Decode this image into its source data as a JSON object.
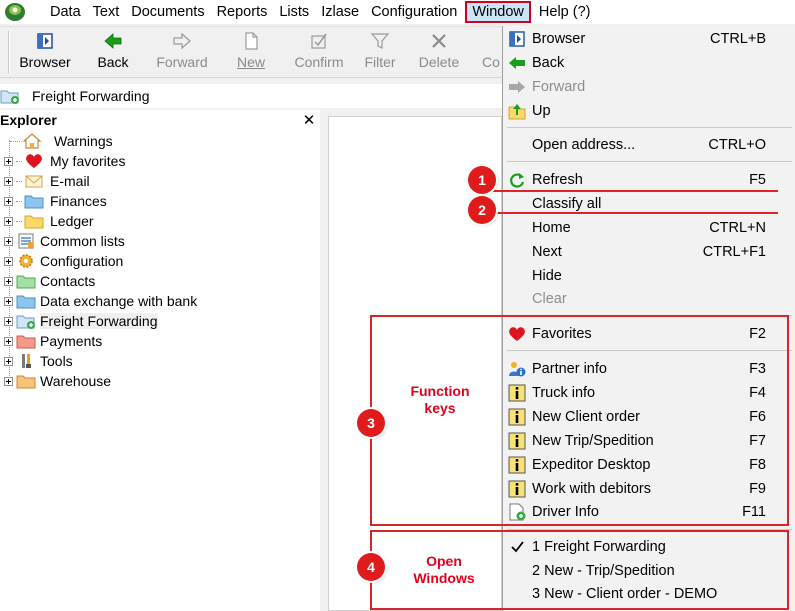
{
  "menubar": {
    "items": [
      "Data",
      "Text",
      "Documents",
      "Reports",
      "Lists",
      "Izlase",
      "Configuration",
      "Window",
      "Help (?)"
    ],
    "active_item": "Window"
  },
  "toolbar": {
    "buttons": [
      {
        "label": "Browser",
        "icon": "browser-icon",
        "enabled": true
      },
      {
        "label": "Back",
        "icon": "arrow-left-icon",
        "enabled": true
      },
      {
        "label": "Forward",
        "icon": "arrow-right-icon",
        "enabled": false
      },
      {
        "label": "New",
        "icon": "new-document-icon",
        "enabled": false
      },
      {
        "label": "Confirm",
        "icon": "confirm-icon",
        "enabled": false
      },
      {
        "label": "Filter",
        "icon": "filter-icon",
        "enabled": false
      },
      {
        "label": "Delete",
        "icon": "delete-icon",
        "enabled": false
      },
      {
        "label": "Co",
        "icon": "",
        "enabled": false
      }
    ]
  },
  "address": {
    "label": "Freight Forwarding",
    "icon": "freight-folder-icon"
  },
  "explorer": {
    "title": "Explorer",
    "close_glyph": "✕",
    "items": [
      {
        "label": "Warnings",
        "icon": "home-warning-icon",
        "expandable": false
      },
      {
        "label": "My favorites",
        "icon": "heart-icon",
        "expandable": true
      },
      {
        "label": "E-mail",
        "icon": "envelope-icon",
        "expandable": true
      },
      {
        "label": "Finances",
        "icon": "folder-blue-icon",
        "expandable": true
      },
      {
        "label": "Ledger",
        "icon": "folder-yellow-icon",
        "expandable": true
      },
      {
        "label": "Common lists",
        "icon": "lists-icon",
        "expandable": true
      },
      {
        "label": "Configuration",
        "icon": "gear-icon",
        "expandable": true
      },
      {
        "label": "Contacts",
        "icon": "folder-green-icon",
        "expandable": true
      },
      {
        "label": "Data exchange with bank",
        "icon": "folder-blue-icon",
        "expandable": true
      },
      {
        "label": "Freight Forwarding",
        "icon": "freight-folder-icon",
        "expandable": true,
        "selected": true
      },
      {
        "label": "Payments",
        "icon": "folder-red-icon",
        "expandable": true
      },
      {
        "label": "Tools",
        "icon": "tools-icon",
        "expandable": true
      },
      {
        "label": "Warehouse",
        "icon": "folder-orange-icon",
        "expandable": true
      }
    ]
  },
  "window_menu": {
    "items": [
      {
        "label": "Browser",
        "shortcut": "CTRL+B",
        "icon": "browser-icon",
        "enabled": true
      },
      {
        "label": "Back",
        "shortcut": "",
        "icon": "arrow-left-icon",
        "enabled": true
      },
      {
        "label": "Forward",
        "shortcut": "",
        "icon": "arrow-right-icon",
        "enabled": false
      },
      {
        "label": "Up",
        "shortcut": "",
        "icon": "folder-up-icon",
        "enabled": true
      },
      {
        "label": "Open address...",
        "shortcut": "CTRL+O",
        "icon": "",
        "enabled": true
      },
      {
        "label": "Refresh",
        "shortcut": "F5",
        "icon": "refresh-icon",
        "enabled": true
      },
      {
        "label": "Classify all",
        "shortcut": "",
        "icon": "",
        "enabled": true
      },
      {
        "label": "Home",
        "shortcut": "CTRL+N",
        "icon": "",
        "enabled": true
      },
      {
        "label": "Next",
        "shortcut": "CTRL+F1",
        "icon": "",
        "enabled": true
      },
      {
        "label": "Hide",
        "shortcut": "",
        "icon": "",
        "enabled": true
      },
      {
        "label": "Clear",
        "shortcut": "",
        "icon": "",
        "enabled": false
      },
      {
        "label": "Favorites",
        "shortcut": "F2",
        "icon": "heart-icon",
        "enabled": true
      },
      {
        "label": "Partner info",
        "shortcut": "F3",
        "icon": "partner-info-icon",
        "enabled": true
      },
      {
        "label": "Truck info",
        "shortcut": "F4",
        "icon": "info-icon",
        "enabled": true
      },
      {
        "label": "New Client order",
        "shortcut": "F6",
        "icon": "info-icon",
        "enabled": true
      },
      {
        "label": "New Trip/Spedition",
        "shortcut": "F7",
        "icon": "info-icon",
        "enabled": true
      },
      {
        "label": "Expeditor Desktop",
        "shortcut": "F8",
        "icon": "info-icon",
        "enabled": true
      },
      {
        "label": "Work with debitors",
        "shortcut": "F9",
        "icon": "info-icon",
        "enabled": true
      },
      {
        "label": "Driver Info",
        "shortcut": "F11",
        "icon": "driver-info-icon",
        "enabled": true
      },
      {
        "label": "1 Freight Forwarding",
        "shortcut": "",
        "icon": "checkmark-icon",
        "enabled": true,
        "checked": true
      },
      {
        "label": "2 New - Trip/Spedition",
        "shortcut": "",
        "icon": "",
        "enabled": true
      },
      {
        "label": "3 New - Client order - DEMO",
        "shortcut": "",
        "icon": "",
        "enabled": true
      }
    ]
  },
  "annotations": {
    "badges": [
      "1",
      "2",
      "3",
      "4"
    ],
    "function_keys_label": [
      "Function",
      "keys"
    ],
    "open_windows_label": [
      "Open",
      "Windows"
    ]
  },
  "colors": {
    "annotation_red": "#e01b1b",
    "menu_highlight": "#cce4f7"
  }
}
